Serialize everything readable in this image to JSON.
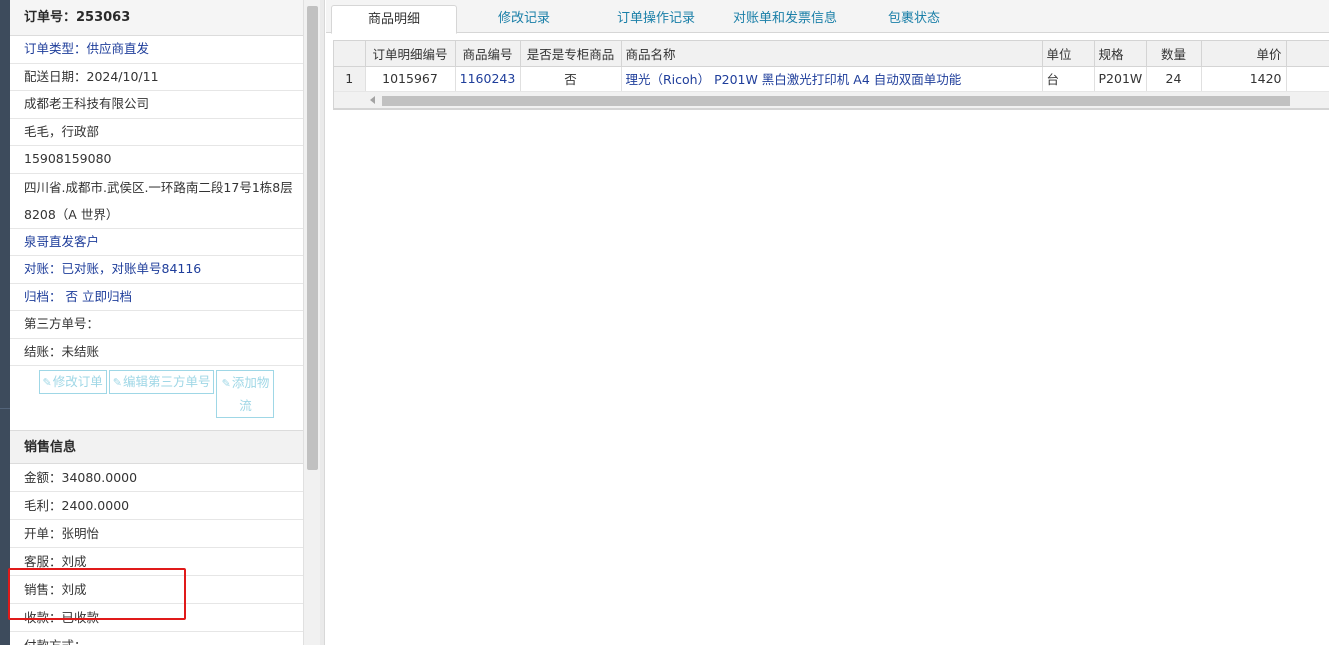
{
  "order": {
    "header": "订单号：253063",
    "rows": [
      {
        "text": "订单类型：供应商直发",
        "blue": true
      },
      {
        "text": "配送日期：2024/10/11",
        "blue": false
      },
      {
        "text": "成都老王科技有限公司",
        "blue": false
      },
      {
        "text": "毛毛，行政部",
        "blue": false
      },
      {
        "text": "15908159080",
        "blue": false
      }
    ],
    "address": "四川省.成都市.武侯区.一环路南二段17号1栋8层8208（A 世界）",
    "rows2": [
      {
        "text": "泉哥直发客户",
        "blue": true
      },
      {
        "text": "对账：已对账，对账单号84116",
        "blue": true
      },
      {
        "text": "归档：  否 立即归档",
        "blue": true
      },
      {
        "text": "第三方单号：",
        "blue": false
      },
      {
        "text": "结账：未结账",
        "blue": false
      }
    ],
    "buttons": {
      "edit_order": "修改订单",
      "edit_third_party": "编辑第三方单号",
      "add_logistics": "添加物流"
    }
  },
  "sales": {
    "header": "销售信息",
    "rows": [
      "金额：34080.0000",
      "毛利：2400.0000",
      "开单：张明怡",
      "客服：刘成",
      "销售：刘成",
      "收款：已收款",
      "付款方式："
    ]
  },
  "tabs": [
    "商品明细",
    "修改记录",
    "订单操作记录",
    "对账单和发票信息",
    "包裹状态"
  ],
  "table": {
    "headers": [
      "",
      "订单明细编号",
      "商品编号",
      "是否是专柜商品",
      "商品名称",
      "单位",
      "规格",
      "数量",
      "单价"
    ],
    "rows": [
      {
        "idx": "1",
        "detail_id": "1015967",
        "product_id": "1160243",
        "counter": "否",
        "name": "理光（Ricoh） P201W 黑白激光打印机 A4 自动双面单功能",
        "unit": "台",
        "spec": "P201W",
        "qty": "24",
        "price": "1420"
      }
    ]
  },
  "colors": {
    "link": "#1f3e9b",
    "tab_link": "#1a7fa8",
    "highlight": "#e01a1a",
    "button_outline": "#9fd7e6"
  }
}
